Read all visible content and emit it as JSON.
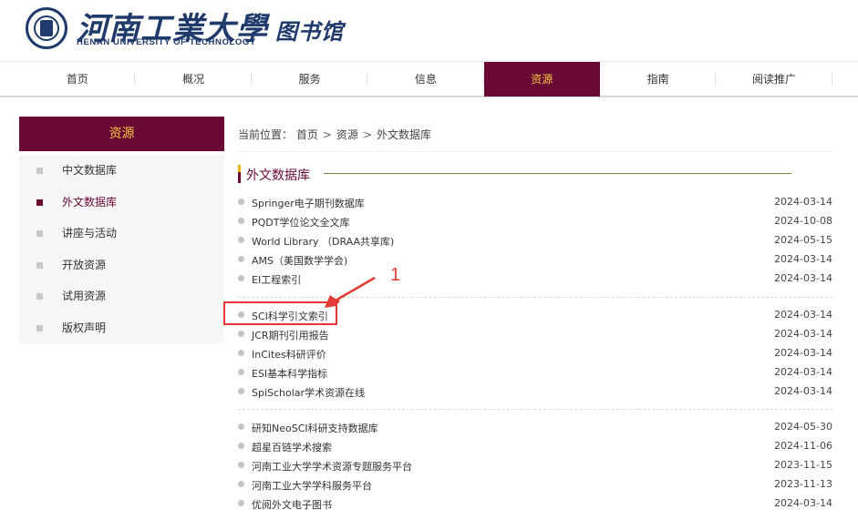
{
  "header": {
    "logo_cn": "河南工業大學",
    "logo_cn_suffix": "图书馆",
    "logo_en": "HENAN UNIVERSITY OF TECHNOLOGY"
  },
  "nav": [
    "首页",
    "概况",
    "服务",
    "信息",
    "资源",
    "指南",
    "阅读推广"
  ],
  "nav_active": 4,
  "sidebar": {
    "title": "资源",
    "items": [
      "中文数据库",
      "外文数据库",
      "讲座与活动",
      "开放资源",
      "试用资源",
      "版权声明"
    ],
    "active": 1
  },
  "breadcrumb": {
    "prefix": "当前位置：",
    "items": [
      "首页",
      "资源",
      "外文数据库"
    ],
    "sep": ">"
  },
  "section_title": "外文数据库",
  "list": [
    {
      "title": "Springer电子期刊数据库",
      "date": "2024-03-14"
    },
    {
      "title": "PQDT学位论文全文库",
      "date": "2024-10-08"
    },
    {
      "title": "World Library （DRAA共享库)",
      "date": "2024-05-15"
    },
    {
      "title": "AMS（美国数学学会)",
      "date": "2024-03-14"
    },
    {
      "title": "EI工程索引",
      "date": "2024-03-14"
    },
    {
      "title": "SCI科学引文索引",
      "date": "2024-03-14"
    },
    {
      "title": "JCR期刊引用报告",
      "date": "2024-03-14"
    },
    {
      "title": "InCites科研评价",
      "date": "2024-03-14"
    },
    {
      "title": "ESI基本科学指标",
      "date": "2024-03-14"
    },
    {
      "title": "SpiScholar学术资源在线",
      "date": "2024-03-14"
    },
    {
      "title": "研知NeoSCI科研支持数据库",
      "date": "2024-05-30"
    },
    {
      "title": "超星百链学术搜索",
      "date": "2024-11-06"
    },
    {
      "title": "河南工业大学学术资源专题服务平台",
      "date": "2023-11-15"
    },
    {
      "title": "河南工业大学学科服务平台",
      "date": "2023-11-13"
    },
    {
      "title": "优阅外文电子图书",
      "date": "2024-03-14"
    }
  ],
  "annotation": {
    "label": "1",
    "color": "#e53935"
  },
  "colors": {
    "brand": "#6a0a34",
    "accent": "#f5c842"
  }
}
